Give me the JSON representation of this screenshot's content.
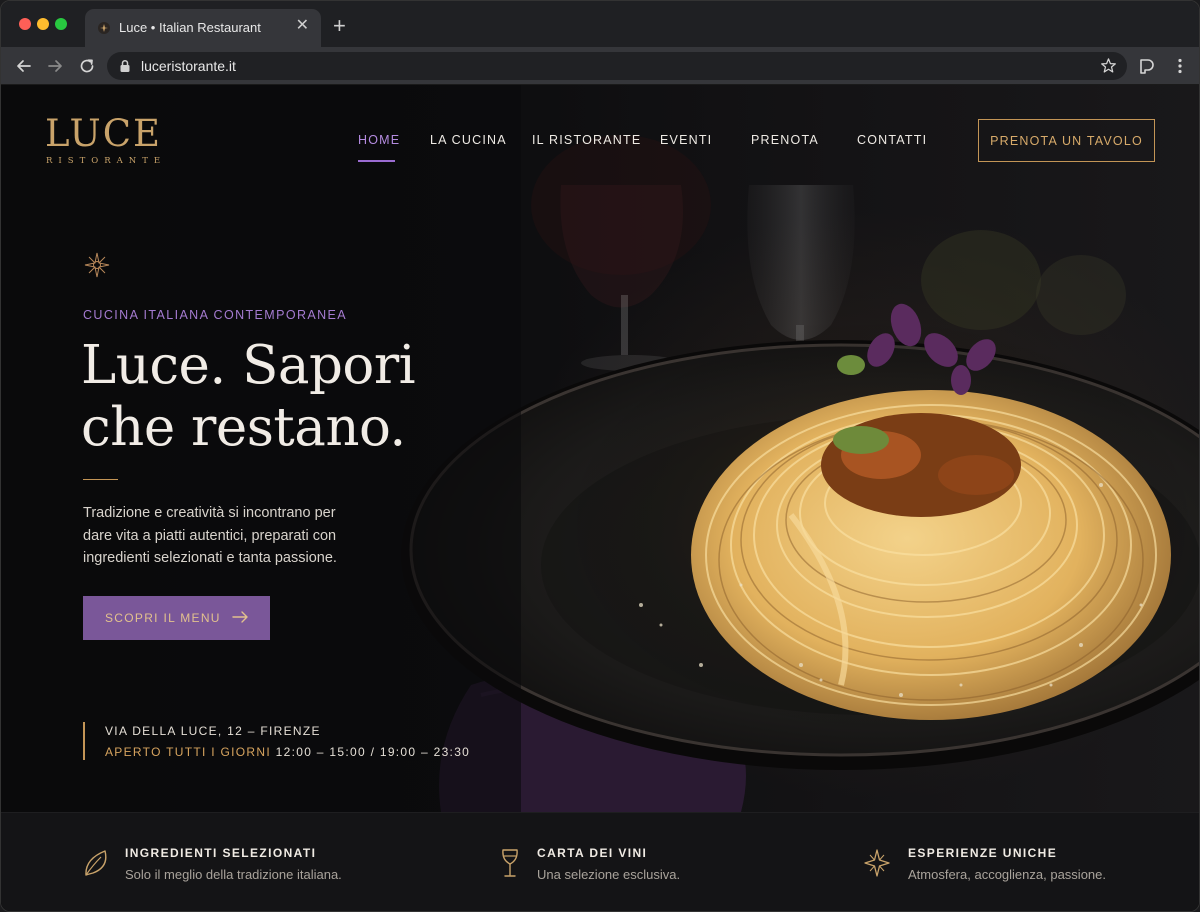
{
  "browser": {
    "tab_title": "Luce • Italian Restaurant",
    "url": "luceristorante.it",
    "icons": [
      "back-arrow-icon",
      "forward-arrow-icon",
      "reload-icon",
      "lock-icon",
      "star-icon",
      "extension-icon",
      "menu-dots-icon"
    ]
  },
  "site": {
    "logo": {
      "word": "LUCE",
      "sub": "RISTORANTE"
    },
    "nav": [
      "HOME",
      "LA CUCINA",
      "IL RISTORANTE",
      "EVENTI",
      "PRENOTA",
      "CONTATTI"
    ],
    "active_nav": "HOME",
    "cta_top": "PRENOTA UN TAVOLO"
  },
  "hero": {
    "eyebrow": "CUCINA ITALIANA CONTEMPORANEA",
    "headline_line1": "Luce. Sapori",
    "headline_line2": "che restano.",
    "intro": "Tradizione e creatività si incontrano per dare vita a piatti autentici, preparati con ingredienti selezionati e tanta passione.",
    "menu_button": "SCOPRI IL MENU",
    "address": "VIA DELLA LUCE, 12 – FIRENZE",
    "hours_label": "APERTO TUTTI I GIORNI",
    "hours_value": "12:00 – 15:00 / 19:00 – 23:30"
  },
  "features": [
    {
      "title": "INGREDIENTI SELEZIONATI",
      "text": "Solo il meglio della tradizione italiana.",
      "icon": "leaf-icon"
    },
    {
      "title": "CARTA DEI VINI",
      "text": "Una selezione esclusiva.",
      "icon": "wine-glass-icon"
    },
    {
      "title": "ESPERIENZE UNICHE",
      "text": "Atmosfera, accoglienza, passione.",
      "icon": "sparkle-icon"
    }
  ],
  "colors": {
    "gold": "#c9a36a",
    "purple": "#7a5799",
    "purple_light": "#a57bd1",
    "background": "#0b0b0c"
  }
}
